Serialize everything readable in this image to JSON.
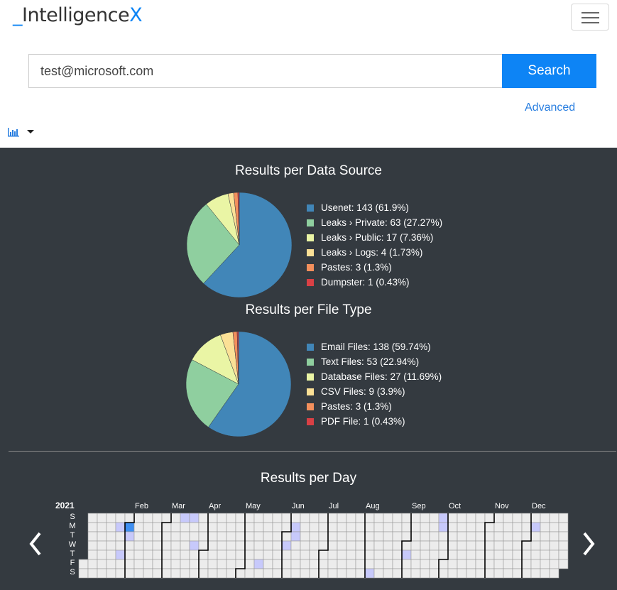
{
  "brand": {
    "prefix": "_",
    "name": "Intelligence",
    "suffix": "X"
  },
  "search": {
    "value": "test@microsoft.com",
    "button": "Search",
    "advanced": "Advanced"
  },
  "colors": {
    "accent": "#0d84f5",
    "dark_bg": "#343a40",
    "cell": "#ececec",
    "cell_low": "#c7c9fb",
    "cell_high": "#3f8ff2"
  },
  "chart_data": [
    {
      "type": "pie",
      "title": "Results per Data Source",
      "labels": [
        "Usenet: 143 (61.9%)",
        "Leaks › Private: 63 (27.27%)",
        "Leaks › Public: 17 (7.36%)",
        "Leaks › Logs: 4 (1.73%)",
        "Pastes: 3 (1.3%)",
        "Dumpster: 1 (0.43%)"
      ],
      "values": [
        143,
        63,
        17,
        4,
        3,
        1
      ],
      "colors": [
        "#4186b8",
        "#8fcf9f",
        "#eaf5a5",
        "#fbe096",
        "#f38f5c",
        "#d94045"
      ]
    },
    {
      "type": "pie",
      "title": "Results per File Type",
      "labels": [
        "Email Files: 138 (59.74%)",
        "Text Files: 53 (22.94%)",
        "Database Files: 27 (11.69%)",
        "CSV Files: 9 (3.9%)",
        "Pastes: 3 (1.3%)",
        "PDF File: 1 (0.43%)"
      ],
      "values": [
        138,
        53,
        27,
        9,
        3,
        1
      ],
      "colors": [
        "#4186b8",
        "#8fcf9f",
        "#eaf5a5",
        "#fbe096",
        "#f38f5c",
        "#d94045"
      ]
    },
    {
      "type": "heatmap",
      "title": "Results per Day",
      "year": "2021",
      "months": [
        "Feb",
        "Mar",
        "Apr",
        "May",
        "Jun",
        "Jul",
        "Aug",
        "Sep",
        "Oct",
        "Nov",
        "Dec"
      ],
      "weekdays": [
        "S",
        "M",
        "T",
        "W",
        "T",
        "F",
        "S"
      ],
      "active_days": [
        {
          "week": 4,
          "day": 1,
          "level": 1
        },
        {
          "week": 5,
          "day": 1,
          "level": 2
        },
        {
          "week": 5,
          "day": 2,
          "level": 1
        },
        {
          "week": 4,
          "day": 4,
          "level": 1
        },
        {
          "week": 11,
          "day": 0,
          "level": 1
        },
        {
          "week": 12,
          "day": 0,
          "level": 1
        },
        {
          "week": 12,
          "day": 3,
          "level": 1
        },
        {
          "week": 19,
          "day": 5,
          "level": 1
        },
        {
          "week": 23,
          "day": 1,
          "level": 1
        },
        {
          "week": 23,
          "day": 2,
          "level": 1
        },
        {
          "week": 22,
          "day": 3,
          "level": 1
        },
        {
          "week": 31,
          "day": 6,
          "level": 1
        },
        {
          "week": 35,
          "day": 4,
          "level": 1
        },
        {
          "week": 39,
          "day": 0,
          "level": 1
        },
        {
          "week": 39,
          "day": 1,
          "level": 1
        },
        {
          "week": 49,
          "day": 1,
          "level": 1
        }
      ]
    }
  ]
}
